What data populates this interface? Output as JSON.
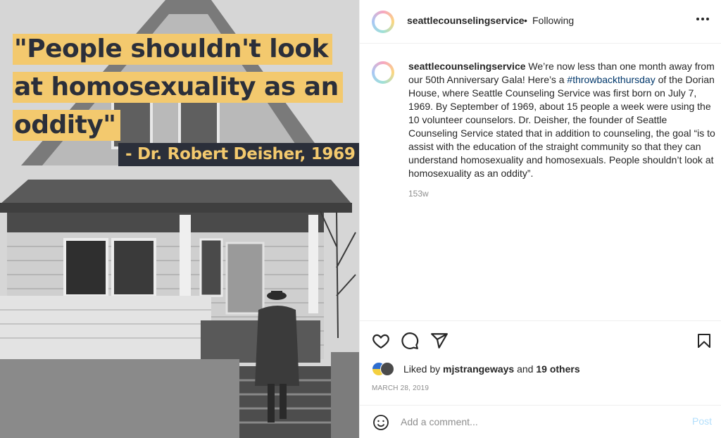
{
  "photo": {
    "quote_line_1": "\"People shouldn't look",
    "quote_line_2": "at homosexuality as an",
    "quote_line_3": "oddity\"",
    "attribution": "- Dr. Robert Deisher, 1969",
    "colors": {
      "highlight": "#f3c96e",
      "quote_text": "#2b2f3a"
    }
  },
  "header": {
    "username": "seattlecounselingservice",
    "separator": "•",
    "follow_status": "Following",
    "more_icon": "more-horizontal-icon"
  },
  "caption": {
    "username": "seattlecounselingservice",
    "text_before": "We’re now less than one month away from our 50th Anniversary Gala! Here’s a ",
    "hashtag": "#throwbackthursday",
    "text_after": " of the Dorian House, where Seattle Counseling Service was first born on July 7, 1969. By September of 1969, about 15 people a week were using the 10 volunteer counselors. Dr. Deisher, the founder of Seattle Counseling Service stated that in addition to counseling, the goal “is to assist with the education of the straight community so that they can understand homosexuality and homosexuals. People shouldn’t look at homosexuality as an oddity”.",
    "age": "153w"
  },
  "actions": {
    "icons": [
      "heart-icon",
      "comment-icon",
      "share-icon",
      "bookmark-icon"
    ],
    "liked_by_prefix": "Liked by",
    "liked_by_user": "mjstrangeways",
    "liked_by_and": "and",
    "liked_by_others": "19 others",
    "date": "MARCH 28, 2019"
  },
  "comment": {
    "emoji_icon": "emoji-icon",
    "placeholder": "Add a comment...",
    "post_label": "Post"
  }
}
